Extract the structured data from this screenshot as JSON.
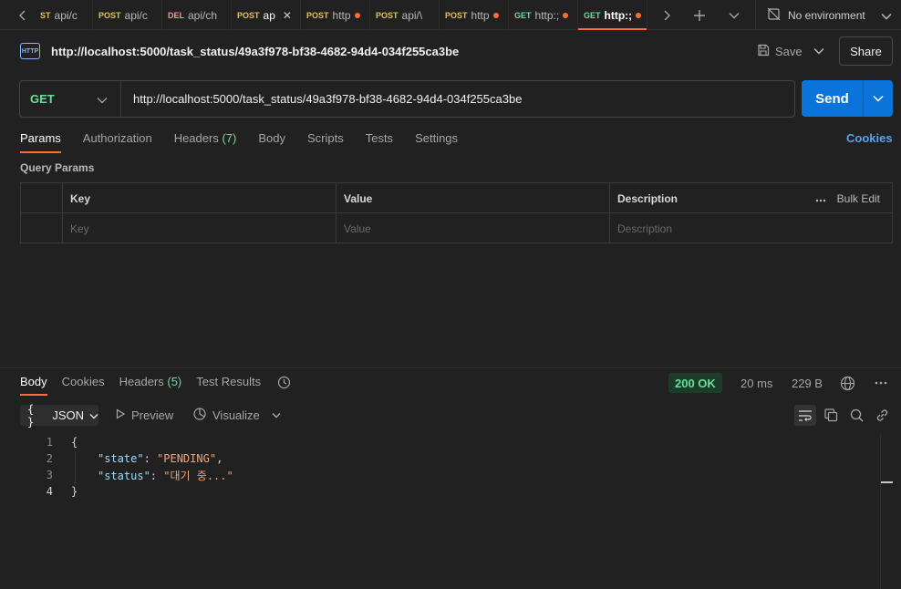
{
  "tabs": [
    {
      "method": "ST",
      "title": "api/c",
      "dot": false
    },
    {
      "method": "POST",
      "title": "api/c",
      "dot": false
    },
    {
      "method": "DEL",
      "title": "api/ch",
      "dot": false
    },
    {
      "method": "POST",
      "title": "ap",
      "dot": false,
      "active_unsaved": true
    },
    {
      "method": "POST",
      "title": "http",
      "dot": true
    },
    {
      "method": "POST",
      "title": "api/\\",
      "dot": false
    },
    {
      "method": "POST",
      "title": "http",
      "dot": true
    },
    {
      "method": "GET",
      "title": "http:;",
      "dot": true
    },
    {
      "method": "GET",
      "title": "http:;",
      "dot": true,
      "active": true
    }
  ],
  "environment": {
    "label": "No environment"
  },
  "request": {
    "icon_label": "HTTP",
    "title": "http://localhost:5000/task_status/49a3f978-bf38-4682-94d4-034f255ca3be",
    "method": "GET",
    "url": "http://localhost:5000/task_status/49a3f978-bf38-4682-94d4-034f255ca3be",
    "save_label": "Save",
    "share_label": "Share",
    "send_label": "Send"
  },
  "request_tabs": [
    {
      "label": "Params",
      "active": true
    },
    {
      "label": "Authorization"
    },
    {
      "label": "Headers",
      "count": "(7)"
    },
    {
      "label": "Body"
    },
    {
      "label": "Scripts"
    },
    {
      "label": "Tests"
    },
    {
      "label": "Settings"
    }
  ],
  "cookies_link": "Cookies",
  "query_params": {
    "section_label": "Query Params",
    "headers": [
      "Key",
      "Value",
      "Description"
    ],
    "placeholders": [
      "Key",
      "Value",
      "Description"
    ],
    "bulk_edit": "Bulk Edit"
  },
  "response": {
    "tabs": [
      {
        "label": "Body",
        "active": true
      },
      {
        "label": "Cookies"
      },
      {
        "label": "Headers",
        "count": "(5)"
      },
      {
        "label": "Test Results"
      }
    ],
    "status": "200 OK",
    "time": "20 ms",
    "size": "229 B",
    "format": "JSON",
    "preview_label": "Preview",
    "visualize_label": "Visualize",
    "lines": [
      {
        "n": "1",
        "text": "{"
      },
      {
        "n": "2",
        "key": "\"state\"",
        "value": "\"PENDING\"",
        "trail": ","
      },
      {
        "n": "3",
        "key": "\"status\"",
        "value": "\"대기 중...\"",
        "trail": ""
      },
      {
        "n": "4",
        "text": "}"
      }
    ]
  },
  "colors": {
    "accent": "#ff6c37",
    "get": "#6bdd9a",
    "post": "#e8c05a",
    "delete": "#f79a8e",
    "send": "#0a74da",
    "link": "#5aa0f2"
  }
}
